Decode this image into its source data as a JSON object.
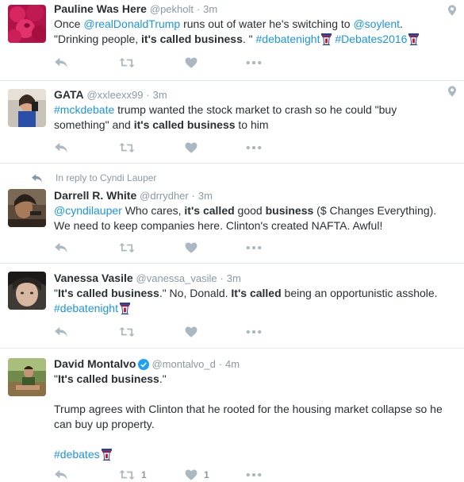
{
  "colors": {
    "link": "#1b95e0",
    "muted": "#8899a6",
    "icon": "#aab8c2",
    "divider": "#e1e8ed",
    "verified": "#1da1f2"
  },
  "tweets": [
    {
      "name": "Pauline Was Here",
      "handle": "@pekholt",
      "dot": "·",
      "time": "3m",
      "text": {
        "p1": "Once ",
        "m1": "@realDonaldTrump",
        "p2": " runs out of water he's switching to ",
        "m2": "@soylent",
        "p3": ".",
        "p4": "\"Drinking people, ",
        "b1": "it's called business",
        "p5": ". \" ",
        "h1": "#debatenight",
        "h2": "#Debates2016"
      }
    },
    {
      "name": "GATA",
      "handle": "@xxleexx99",
      "dot": "·",
      "time": "3m",
      "text": {
        "h1": "#mckdebate",
        "p1": " trump wanted the stock market to crash so he could \"buy something\" and ",
        "b1": "it's called business",
        "p2": " to him"
      }
    },
    {
      "reply_context": "In reply to Cyndi Lauper",
      "name": "Darrell R. White",
      "handle": "@drrydher",
      "dot": "·",
      "time": "3m",
      "text": {
        "m1": "@cyndilauper",
        "p1": " Who cares, ",
        "b1": "it's called",
        "p2": " good ",
        "b2": "business",
        "p3": " ($ Changes Everything). We need to keep companies here. Clinton's created NAFTA. Awful!"
      }
    },
    {
      "name": "Vanessa Vasile",
      "handle": "@vanessa_vasile",
      "dot": "·",
      "time": "3m",
      "text": {
        "p1": "\"",
        "b1": "It's called business",
        "p2": ".\" No, Donald. ",
        "b2": "It's called",
        "p3": " being an opportunistic asshole.",
        "h1": "#debatenight"
      }
    },
    {
      "name": "David Montalvo",
      "handle": "@montalvo_d",
      "dot": "·",
      "time": "4m",
      "verified": true,
      "text": {
        "p1": "\"",
        "b1": "It's called business",
        "p2": ".\"",
        "p3": "Trump agrees with Clinton that he rooted for the housing market collapse so he can buy up property.",
        "h1": "#debates"
      },
      "retweets": "1",
      "likes": "1"
    }
  ]
}
